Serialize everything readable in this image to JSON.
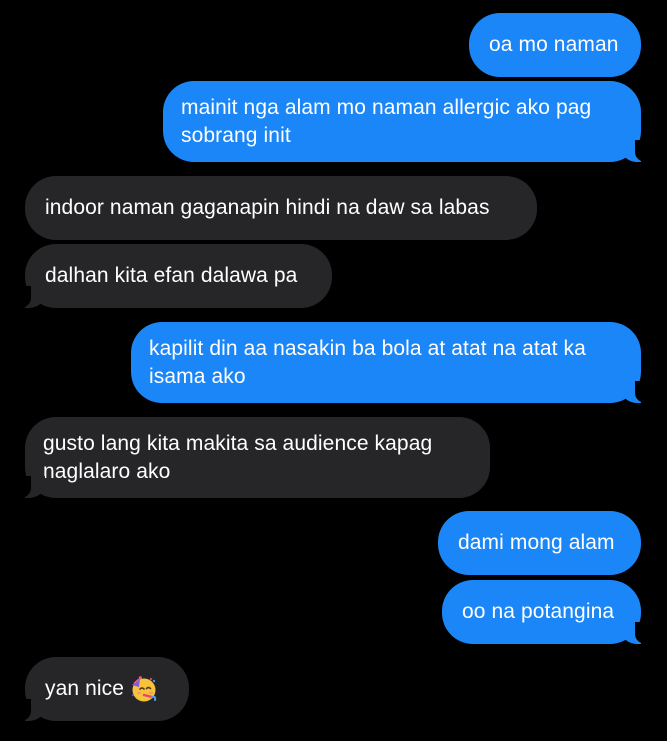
{
  "messages": [
    {
      "side": "sent",
      "text": "oa mo naman"
    },
    {
      "side": "sent",
      "text": "mainit nga alam mo naman allergic ako pag sobrang init"
    },
    {
      "side": "received",
      "text": "indoor naman gaganapin hindi na daw sa labas"
    },
    {
      "side": "received",
      "text": "dalhan kita efan dalawa pa"
    },
    {
      "side": "sent",
      "text": "kapilit din aa nasakin ba bola at atat na atat ka isama ako"
    },
    {
      "side": "received",
      "text": "gusto lang kita makita sa audience kapag naglalaro ako"
    },
    {
      "side": "sent",
      "text": "dami mong alam"
    },
    {
      "side": "sent",
      "text": "oo na potangina"
    },
    {
      "side": "received",
      "text": "yan nice",
      "emoji": "partying-face-icon"
    }
  ],
  "colors": {
    "sent_bubble": "#1b86f8",
    "received_bubble": "#262628",
    "background": "#000000",
    "text": "#ffffff"
  }
}
